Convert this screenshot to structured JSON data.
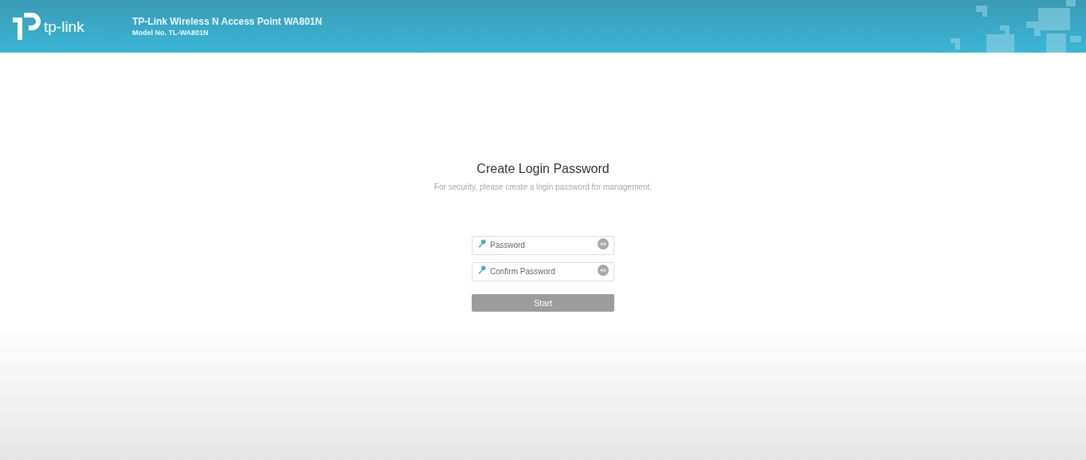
{
  "header": {
    "logo_text": "tp-link",
    "title": "TP-Link Wireless N Access Point WA801N",
    "model": "Model No. TL-WA801N"
  },
  "form": {
    "title": "Create Login Password",
    "subtitle": "For security, please create a login password for management.",
    "fields": [
      {
        "placeholder": "Password"
      },
      {
        "placeholder": "Confirm Password"
      }
    ],
    "button": {
      "label": "Start",
      "disabled": true
    }
  }
}
